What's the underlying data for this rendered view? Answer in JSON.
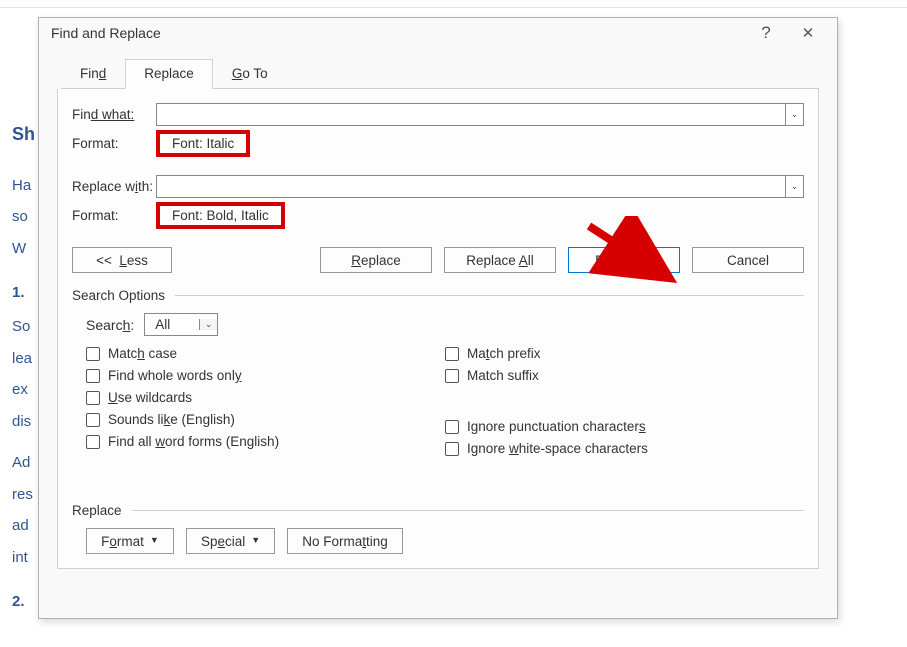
{
  "background": {
    "heading": "Sh",
    "lines": [
      "Ha",
      "so",
      "W"
    ],
    "num1": "1.",
    "para2": [
      "So",
      "lea",
      "ex",
      "dis"
    ],
    "para3": [
      "Ad",
      "res",
      "ad",
      "int"
    ],
    "num2": "2."
  },
  "dialog": {
    "title": "Find and Replace",
    "help": "?",
    "close": "✕",
    "tabs": {
      "find": "d",
      "find_pre": "Fin",
      "replace": "place",
      "replace_pre": "Re",
      "goto": "o To",
      "goto_pre": "G"
    },
    "find_label": "d what:",
    "find_pre": "Fin",
    "find_value": "",
    "format_label": "Format:",
    "find_format": "Font: Italic",
    "replace_label": "th:",
    "replace_pre": "Replace w",
    "replace_mid": "i",
    "replace_value": "",
    "replace_format": "Font: Bold, Italic",
    "less": "<<  Less",
    "less_u": "L",
    "replace_btn": "eplace",
    "replace_btn_u": "R",
    "replace_all": "ll",
    "replace_all_pre": "Replace ",
    "replace_all_u": "A",
    "find_next": "ind Next",
    "find_next_u": "F",
    "cancel": "Cancel",
    "search_options": "Search Options",
    "search_lbl": "Searc",
    "search_u": "h",
    "search_suf": ":",
    "search_val": "All",
    "chk": {
      "match_case": "Matc",
      "match_case_u": "h",
      "match_case_suf": " case",
      "whole": "Find whole words onl",
      "whole_u": "y",
      "wild": "se wildcards",
      "wild_u": "U",
      "sounds": "Sounds li",
      "sounds_u": "k",
      "sounds_suf": "e (English)",
      "forms": "Find all ",
      "forms_u": "w",
      "forms_suf": "ord forms (English)",
      "prefix": "Ma",
      "prefix_u": "t",
      "prefix_suf": "ch prefix",
      "suffix": "Match suffix",
      "punct": "Ignore punctuation character",
      "punct_u": "s",
      "space": "Ignore ",
      "space_u": "w",
      "space_suf": "hite-space characters"
    },
    "replace_sec": "Replace",
    "format_btn": "F",
    "format_btn_suf": "rmat",
    "format_btn_u": "o",
    "special": "Sp",
    "special_u": "e",
    "special_suf": "cial",
    "noformat": "No Forma",
    "noformat_u": "t",
    "noformat_suf": "ting"
  }
}
